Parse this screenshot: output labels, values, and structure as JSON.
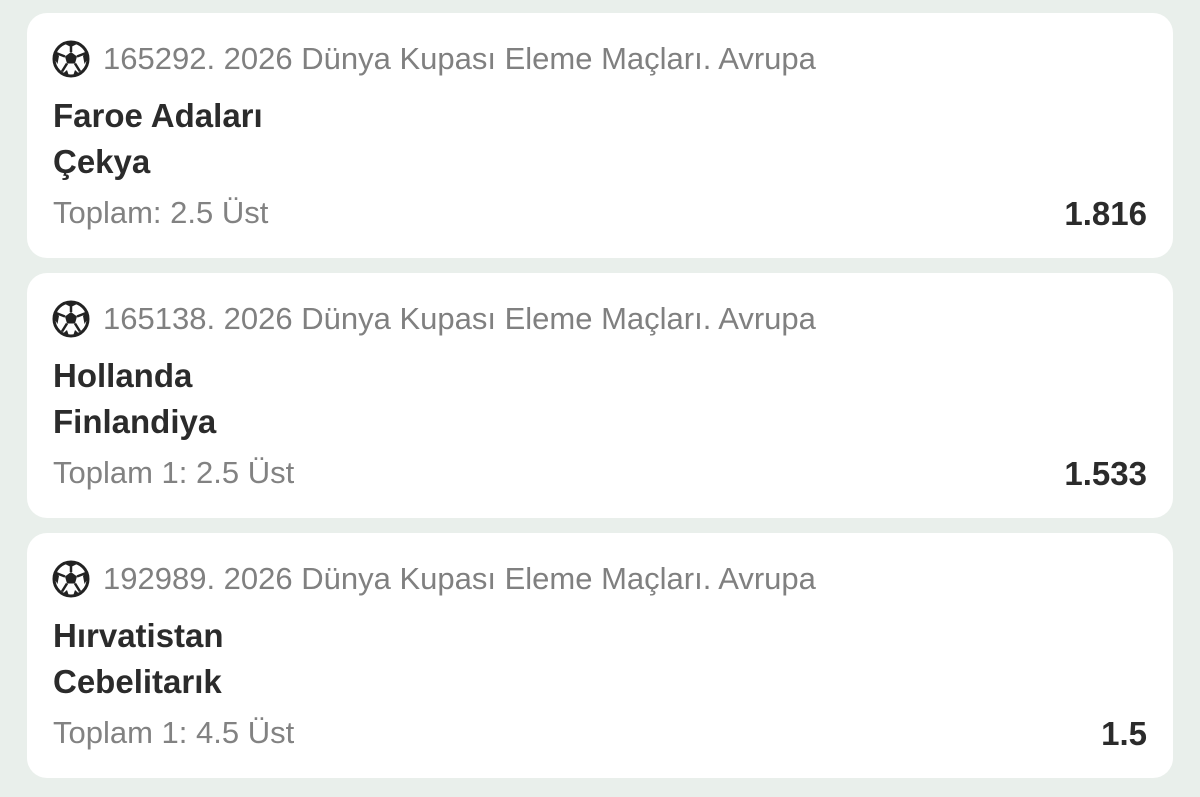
{
  "bets": [
    {
      "league": "165292. 2026 Dünya Kupası Eleme Maçları. Avrupa",
      "home_team": "Faroe Adaları",
      "away_team": "Çekya",
      "market": "Toplam: 2.5 Üst",
      "odds": "1.816",
      "icon": "soccer-ball-icon"
    },
    {
      "league": "165138. 2026 Dünya Kupası Eleme Maçları. Avrupa",
      "home_team": "Hollanda",
      "away_team": "Finlandiya",
      "market": "Toplam 1: 2.5 Üst",
      "odds": "1.533",
      "icon": "soccer-ball-icon"
    },
    {
      "league": "192989. 2026 Dünya Kupası Eleme Maçları. Avrupa",
      "home_team": "Hırvatistan",
      "away_team": "Cebelitarık",
      "market": "Toplam 1: 4.5 Üst",
      "odds": "1.5",
      "icon": "soccer-ball-icon"
    }
  ],
  "colors": {
    "background": "#e9efeb",
    "card": "#ffffff",
    "primary_text": "#2b2b2b",
    "secondary_text": "#808080"
  }
}
